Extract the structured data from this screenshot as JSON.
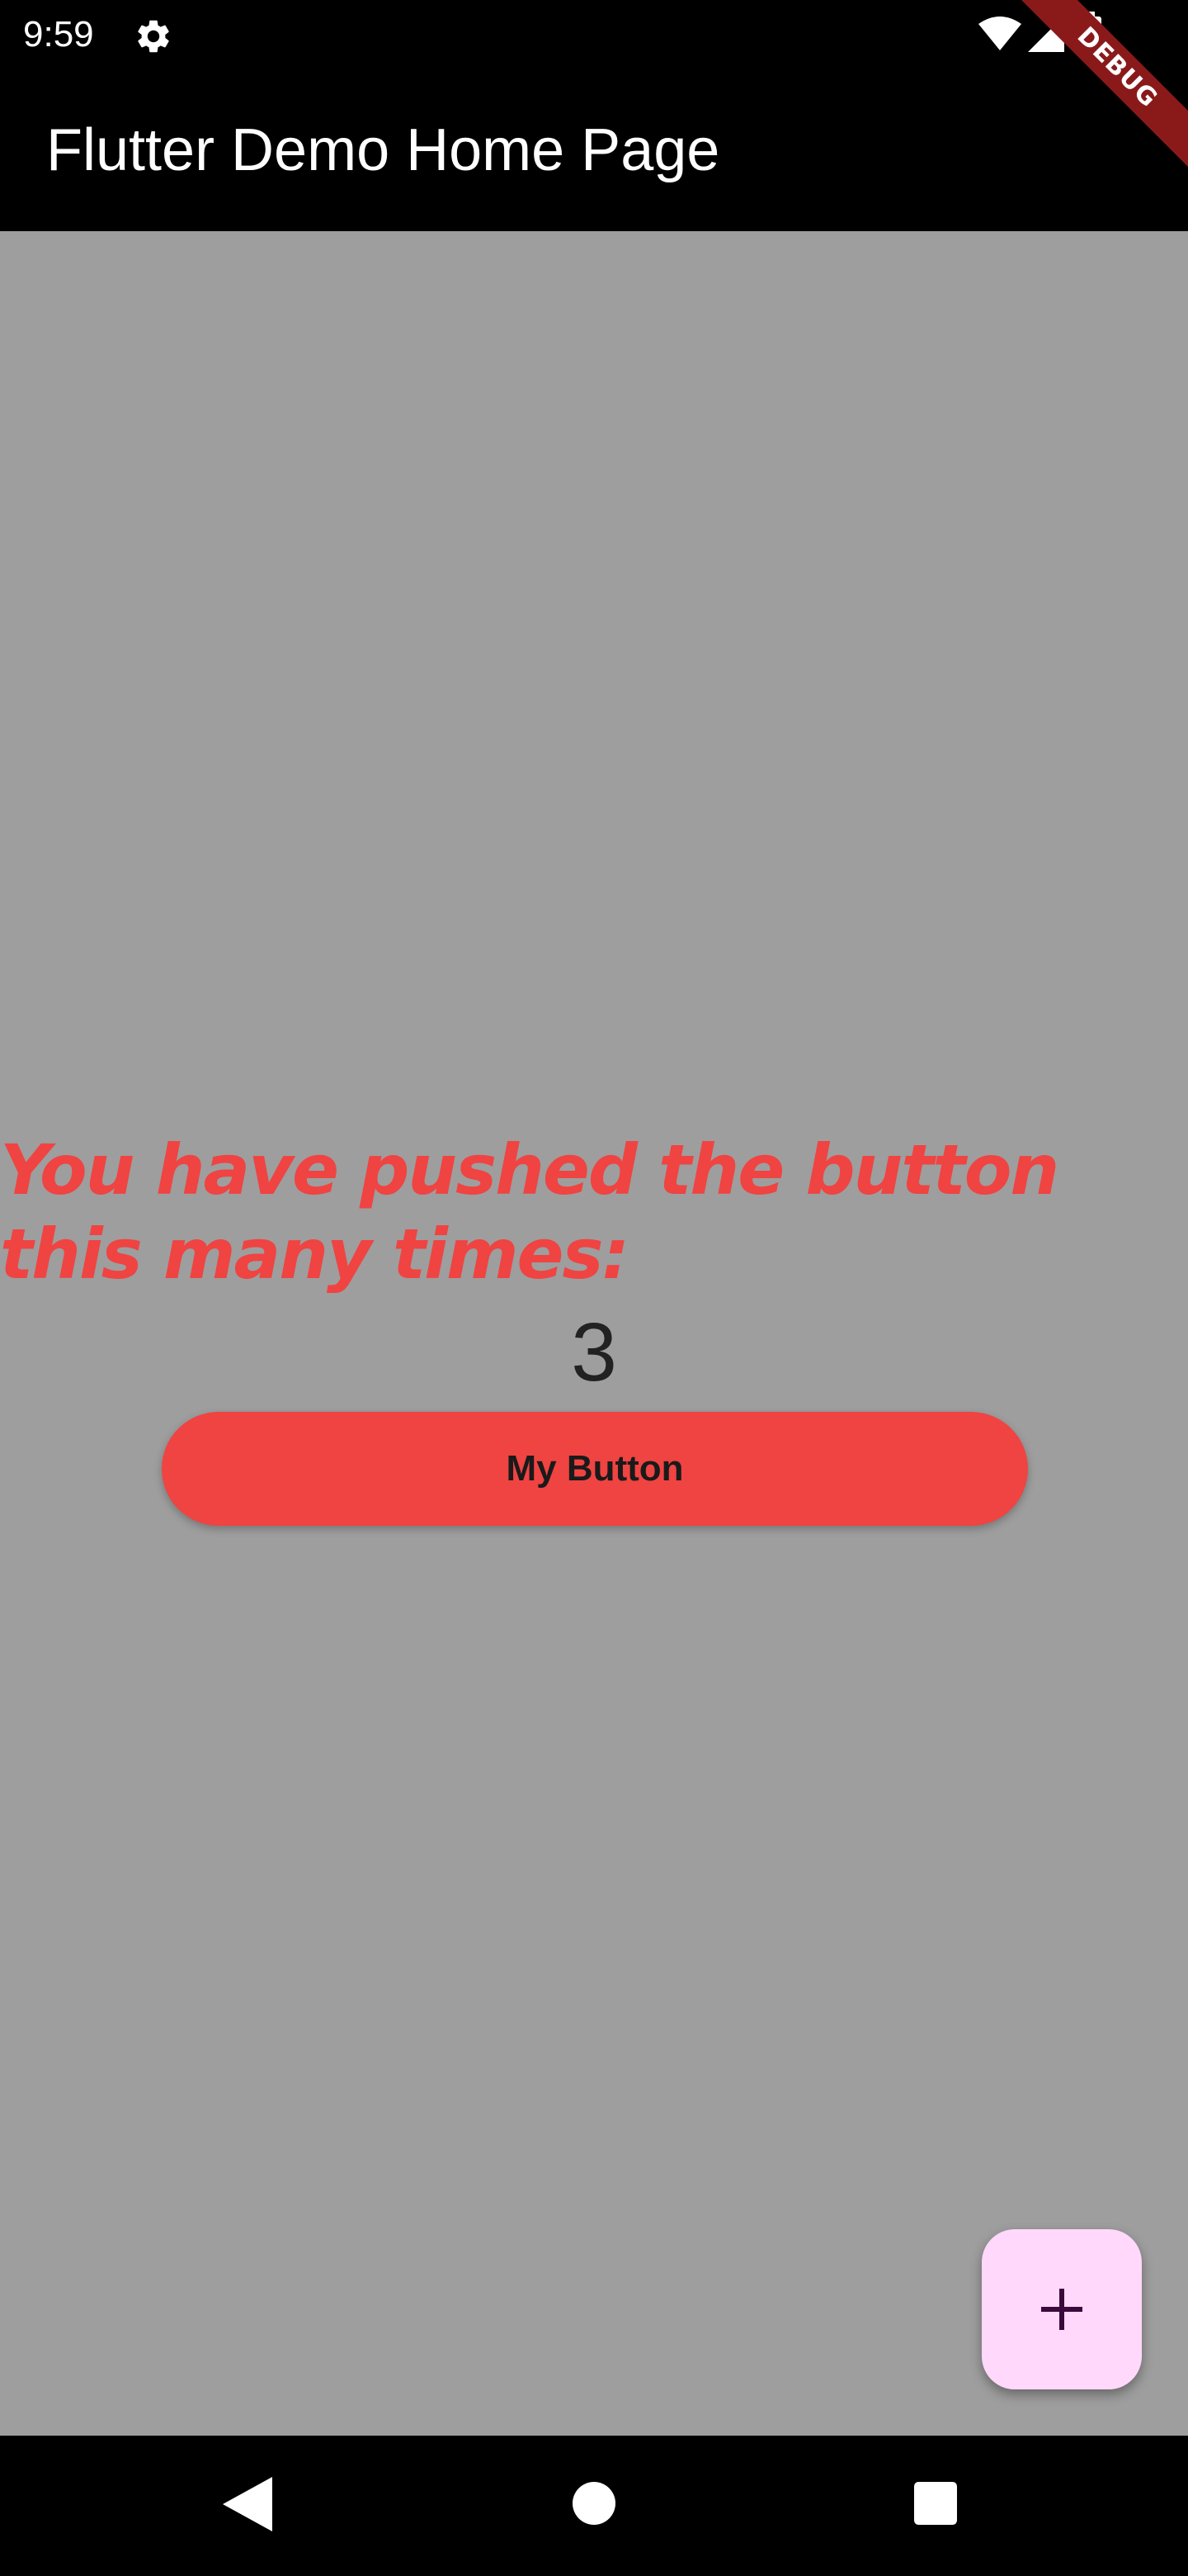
{
  "status_bar": {
    "time": "9:59",
    "icons": [
      "gear-icon",
      "wifi-icon",
      "signal-icon",
      "battery-icon"
    ]
  },
  "app_bar": {
    "title": "Flutter Demo Home Page"
  },
  "debug_banner": {
    "label": "DEBUG"
  },
  "main": {
    "prompt": "You have pushed the button this many times:",
    "counter": "3",
    "button_label": "My Button"
  },
  "fab": {
    "icon": "plus-icon"
  },
  "nav_bar": {
    "icons": [
      "back-icon",
      "home-icon",
      "recents-icon"
    ]
  },
  "colors": {
    "body_background": "#9e9e9e",
    "accent_red": "#ef4442",
    "fab_background": "#ffd8fb",
    "fab_icon": "#3a0a3a",
    "bars_background": "#000000"
  }
}
